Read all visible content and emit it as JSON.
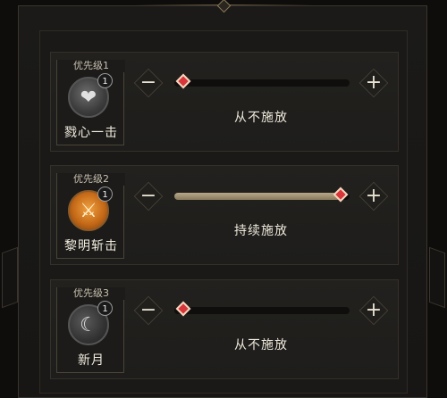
{
  "skills": [
    {
      "priority_label": "优先级1",
      "badge": "1",
      "name": "戮心一击",
      "icon": "heart-icon",
      "icon_style": "gray",
      "level": 0,
      "status": "从不施放"
    },
    {
      "priority_label": "优先级2",
      "badge": "1",
      "name": "黎明斩击",
      "icon": "crossed-swords-icon",
      "icon_style": "orange",
      "level": 1,
      "status": "持续施放"
    },
    {
      "priority_label": "优先级3",
      "badge": "1",
      "name": "新月",
      "icon": "crescent-moon-icon",
      "icon_style": "dark",
      "level": 0,
      "status": "从不施放"
    }
  ],
  "controls": {
    "minus_label": "−",
    "plus_label": "+"
  },
  "colors": {
    "knob": "#d8363a",
    "fill": "#b8a88a",
    "accent_orange": "#c56a18"
  }
}
